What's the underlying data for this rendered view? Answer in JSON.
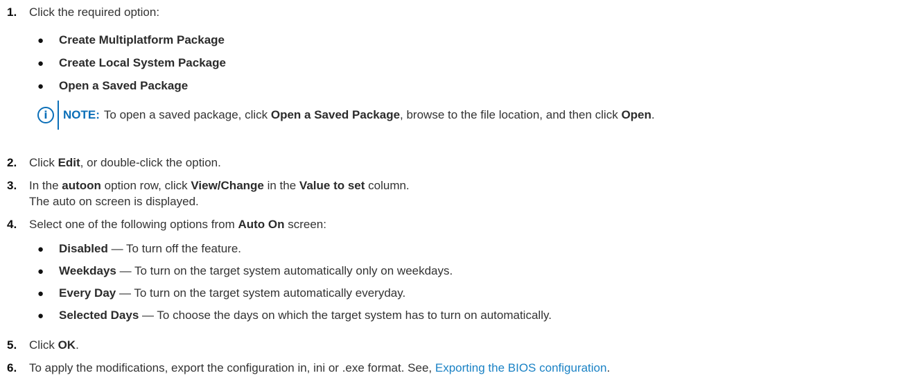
{
  "steps": {
    "s1": {
      "num": "1.",
      "text": "Click the required option:",
      "options": [
        "Create Multiplatform Package",
        "Create Local System Package",
        "Open a Saved Package"
      ],
      "note": {
        "label": "NOTE:",
        "p1": "To open a saved package, click ",
        "b1": "Open a Saved Package",
        "p2": ", browse to the file location, and then click ",
        "b2": "Open",
        "p3": "."
      }
    },
    "s2": {
      "num": "2.",
      "p1": "Click ",
      "b1": "Edit",
      "p2": ", or double-click the option."
    },
    "s3": {
      "num": "3.",
      "p1": "In the ",
      "b1": "autoon",
      "p2": " option row, click ",
      "b2": "View/Change",
      "p3": " in the ",
      "b3": "Value to set",
      "p4": " column.",
      "result": "The auto on screen is displayed."
    },
    "s4": {
      "num": "4.",
      "p1": "Select one of the following options from ",
      "b1": "Auto On",
      "p2": " screen:",
      "options": [
        {
          "name": "Disabled",
          "desc": " — To turn off the feature."
        },
        {
          "name": "Weekdays",
          "desc": " — To turn on the target system automatically only on weekdays."
        },
        {
          "name": "Every Day",
          "desc": " — To turn on the target system automatically everyday."
        },
        {
          "name": "Selected Days",
          "desc": " — To choose the days on which the target system has to turn on automatically."
        }
      ]
    },
    "s5": {
      "num": "5.",
      "p1": "Click ",
      "b1": "OK",
      "p2": "."
    },
    "s6": {
      "num": "6.",
      "p1": "To apply the modifications, export the configuration in, ini or .exe format. See, ",
      "link": "Exporting the BIOS configuration",
      "p2": "."
    }
  },
  "colors": {
    "accent": "#0b6fb8",
    "link": "#1a82c5",
    "text": "#333333"
  },
  "icons": {
    "note": "info-icon",
    "bullet": "bullet-dot"
  }
}
